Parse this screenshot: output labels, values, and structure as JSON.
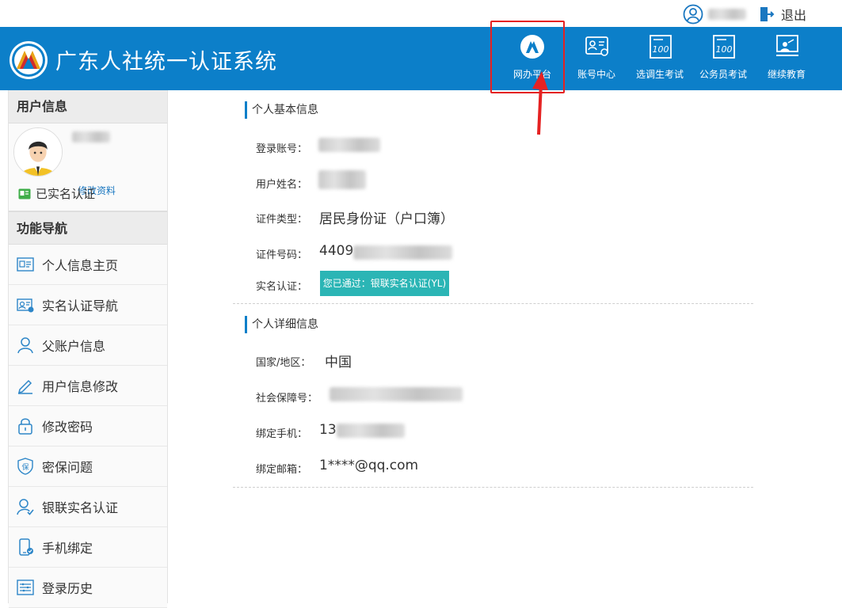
{
  "topbar": {
    "logout_label": "退出"
  },
  "header": {
    "site_title": "广东人社统一认证系统",
    "nav": [
      {
        "label": "网办平台",
        "icon": "portal-icon"
      },
      {
        "label": "账号中心",
        "icon": "account-card-icon"
      },
      {
        "label": "选调生考试",
        "icon": "exam-100-icon"
      },
      {
        "label": "公务员考试",
        "icon": "exam-100-icon"
      },
      {
        "label": "继续教育",
        "icon": "teacher-board-icon"
      }
    ]
  },
  "sidebar": {
    "user_info_title": "用户信息",
    "edit_profile": "修改资料",
    "verified_label": "已实名认证",
    "nav_title": "功能导航",
    "items": [
      {
        "label": "个人信息主页",
        "icon": "id-card-icon"
      },
      {
        "label": "实名认证导航",
        "icon": "verify-card-icon"
      },
      {
        "label": "父账户信息",
        "icon": "user-icon"
      },
      {
        "label": "用户信息修改",
        "icon": "pencil-icon"
      },
      {
        "label": "修改密码",
        "icon": "lock-icon"
      },
      {
        "label": "密保问题",
        "icon": "shield-icon"
      },
      {
        "label": "银联实名认证",
        "icon": "user-check-icon"
      },
      {
        "label": "手机绑定",
        "icon": "phone-icon"
      },
      {
        "label": "登录历史",
        "icon": "history-list-icon"
      }
    ]
  },
  "main": {
    "basic_title": "个人基本信息",
    "basic": {
      "login_account_label": "登录账号：",
      "user_name_label": "用户姓名：",
      "id_type_label": "证件类型：",
      "id_type_value": "居民身份证（户口簿）",
      "id_number_label": "证件号码：",
      "id_number_value": "4409",
      "real_name_label": "实名认证：",
      "real_name_badge": "您已通过：银联实名认证(YL)"
    },
    "detail_title": "个人详细信息",
    "detail": {
      "country_label": "国家/地区：",
      "country_value": "中国",
      "ssn_label": "社会保障号：",
      "phone_label": "绑定手机：",
      "phone_value": "13",
      "email_label": "绑定邮箱：",
      "email_value": "1****@qq.com"
    }
  },
  "colors": {
    "header_blue": "#0c7fc9",
    "badge_teal": "#2bb5b5",
    "highlight_red": "#e52222"
  }
}
